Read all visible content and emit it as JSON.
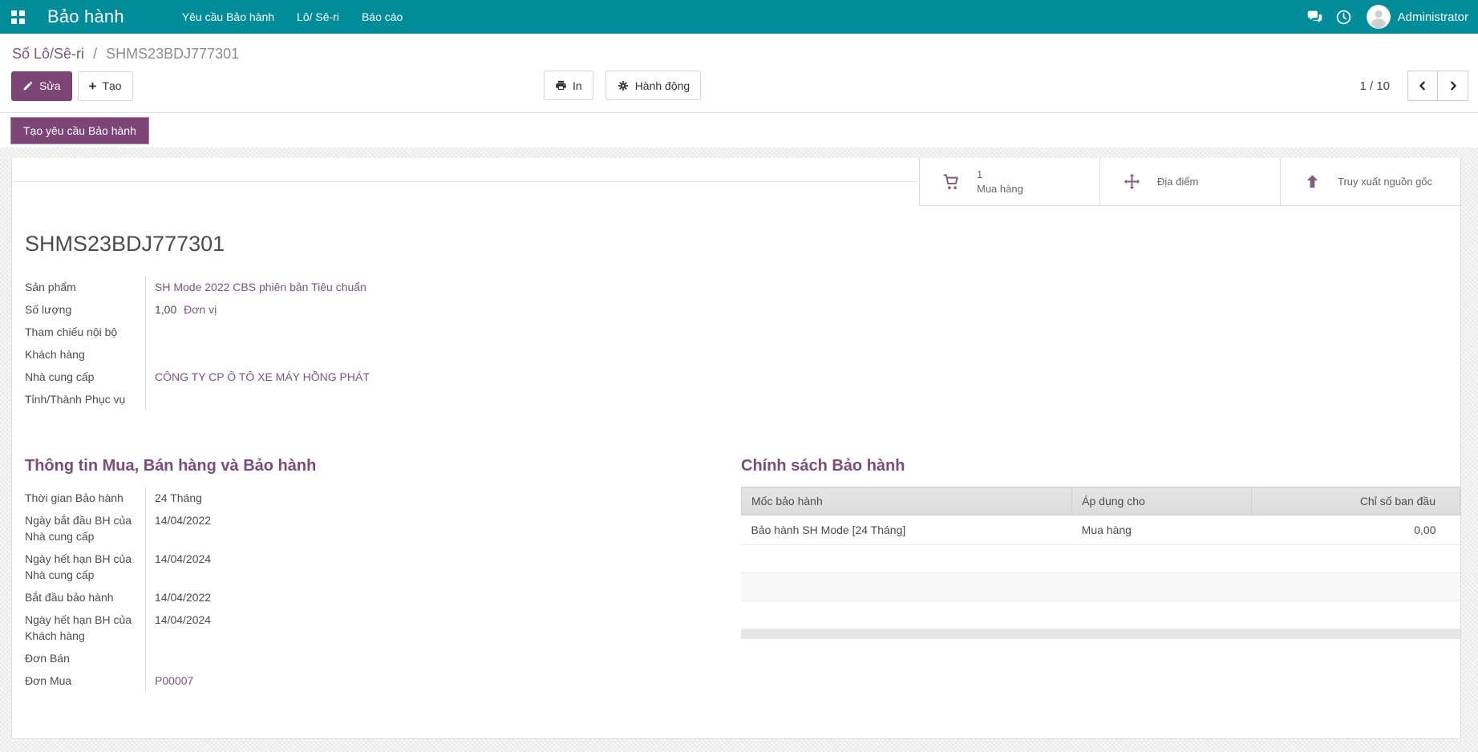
{
  "colors": {
    "nav_teal": "#008d99",
    "primary_purple": "#7c4576",
    "link_purple": "#7f537f",
    "heading_purple": "#7d4a80"
  },
  "nav": {
    "app_title": "Bảo hành",
    "menus": [
      {
        "label": "Yêu cầu Bảo hành"
      },
      {
        "label": "Lô/ Sê-ri"
      },
      {
        "label": "Báo cáo"
      }
    ],
    "icons": [
      "apps-grid-icon",
      "chat-icon",
      "clock-icon",
      "avatar"
    ],
    "user_name": "Administrator"
  },
  "breadcrumb": {
    "parent": "Số Lô/Sê-ri",
    "separator": "/",
    "current": "SHMS23BDJ777301"
  },
  "control_panel": {
    "edit_label": "Sửa",
    "create_label": "Tạo",
    "print_label": "In",
    "action_label": "Hành động",
    "pager": {
      "text": "1 / 10",
      "current": "1",
      "total": "10"
    }
  },
  "statusbar": {
    "create_claim_label": "Tạo yêu cầu Bảo hành"
  },
  "stat_buttons": [
    {
      "icon": "shopping-cart-icon",
      "value": "1",
      "label": "Mua hàng"
    },
    {
      "icon": "arrows-move-icon",
      "label": "Địa điểm"
    },
    {
      "icon": "arrow-up-icon",
      "label": "Truy xuất nguồn gốc"
    }
  ],
  "record": {
    "title": "SHMS23BDJ777301",
    "fields": [
      {
        "label": "Sản phẩm",
        "value": "SH Mode 2022 CBS phiên bản Tiêu chuẩn"
      },
      {
        "label": "Số lượng",
        "value": "1,00",
        "suffix": "Đơn vị"
      },
      {
        "label": "Tham chiếu nội bộ",
        "value": ""
      },
      {
        "label": "Khách hàng",
        "value": ""
      },
      {
        "label": "Nhà cung cấp",
        "value": "CÔNG TY CP Ô TÔ XE MÁY HỒNG PHÁT"
      },
      {
        "label": "Tỉnh/Thành Phục vụ",
        "value": ""
      }
    ]
  },
  "warranty_info": {
    "heading": "Thông tin Mua, Bán hàng và Bảo hành",
    "fields": [
      {
        "label": "Thời gian Bảo hành",
        "value": "24 Tháng"
      },
      {
        "label": "Ngày bắt đầu BH của Nhà cung cấp",
        "value": "14/04/2022"
      },
      {
        "label": "Ngày hết hạn BH của Nhà cung cấp",
        "value": "14/04/2024"
      },
      {
        "label": "Bắt đầu bảo hành",
        "value": "14/04/2022"
      },
      {
        "label": "Ngày hết hạn BH của Khách hàng",
        "value": "14/04/2024"
      },
      {
        "label": "Đơn Bán",
        "value": ""
      },
      {
        "label": "Đơn Mua",
        "value": "P00007"
      }
    ]
  },
  "warranty_policy": {
    "heading": "Chính sách Bảo hành",
    "table": {
      "columns": [
        "Mốc bảo hành",
        "Áp dụng cho",
        "Chỉ số ban đầu"
      ],
      "rows": [
        [
          "Bảo hành SH Mode [24 Tháng]",
          "Mua hàng",
          "0,00"
        ]
      ]
    }
  }
}
